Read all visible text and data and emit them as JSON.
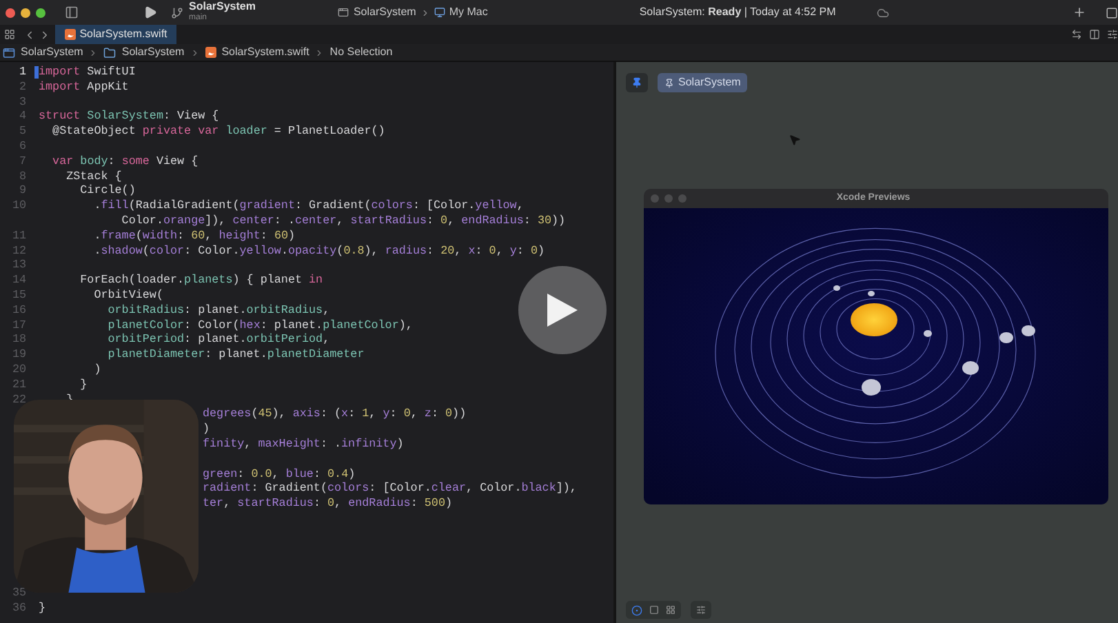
{
  "toolbar": {
    "project": "SolarSystem",
    "branch": "main",
    "scheme": "SolarSystem",
    "destination": "My Mac",
    "status": "SolarSystem: **Ready** | Today at 4:52 PM"
  },
  "tabs": [
    {
      "label": "SolarSystem.swift",
      "selected": true
    }
  ],
  "breadcrumb": [
    {
      "kind": "project",
      "label": "SolarSystem"
    },
    {
      "kind": "folder",
      "label": "SolarSystem"
    },
    {
      "kind": "swift",
      "label": "SolarSystem.swift"
    },
    {
      "kind": "plain",
      "label": "No Selection"
    }
  ],
  "editor": {
    "lines": [
      {
        "kind": "code",
        "number": "1",
        "current": true,
        "tokens": [
          {
            "kind": "keyword",
            "text": "import"
          },
          {
            "kind": "plain",
            "text": " SwiftUI"
          }
        ]
      },
      {
        "kind": "code",
        "number": "2",
        "current": false,
        "tokens": [
          {
            "kind": "keyword",
            "text": "import"
          },
          {
            "kind": "plain",
            "text": " AppKit"
          }
        ]
      },
      {
        "kind": "code",
        "number": "3",
        "current": false
      },
      {
        "kind": "code",
        "number": "4",
        "current": false,
        "tokens": [
          {
            "kind": "keyword",
            "text": "struct"
          },
          {
            "kind": "declared",
            "text": " SolarSystem"
          },
          {
            "kind": "plain",
            "text": ": View {"
          }
        ]
      },
      {
        "kind": "code",
        "number": "5",
        "current": false,
        "tokens": [
          {
            "kind": "plain",
            "text": "  @StateObject "
          },
          {
            "kind": "keyword",
            "text": "private var"
          },
          {
            "kind": "declared",
            "text": " loader"
          },
          {
            "kind": "plain",
            "text": " = PlanetLoader()"
          }
        ]
      },
      {
        "kind": "code",
        "number": "6",
        "current": false
      },
      {
        "kind": "code",
        "number": "7",
        "current": false,
        "tokens": [
          {
            "kind": "keyword",
            "text": "  var"
          },
          {
            "kind": "declared",
            "text": " body"
          },
          {
            "kind": "plain",
            "text": ": "
          },
          {
            "kind": "keyword",
            "text": "some"
          },
          {
            "kind": "plain",
            "text": " View {"
          }
        ]
      },
      {
        "kind": "code",
        "number": "8",
        "current": false,
        "tokens": [
          {
            "kind": "plain",
            "text": "    ZStack {"
          }
        ]
      },
      {
        "kind": "code",
        "number": "9",
        "current": false,
        "tokens": [
          {
            "kind": "plain",
            "text": "      Circle()"
          }
        ]
      },
      {
        "kind": "code",
        "number": "10",
        "current": false,
        "tokens": [
          {
            "kind": "plain",
            "text": "        ."
          },
          {
            "kind": "member",
            "text": "fill"
          },
          {
            "kind": "plain",
            "text": "(RadialGradient("
          },
          {
            "kind": "member",
            "text": "gradient"
          },
          {
            "kind": "plain",
            "text": ": Gradient("
          },
          {
            "kind": "member",
            "text": "colors"
          },
          {
            "kind": "plain",
            "text": ": [Color."
          },
          {
            "kind": "member",
            "text": "yellow"
          },
          {
            "kind": "plain",
            "text": ","
          }
        ]
      },
      {
        "kind": "wrap",
        "tokens": [
          {
            "kind": "plain",
            "text": "            Color."
          },
          {
            "kind": "member",
            "text": "orange"
          },
          {
            "kind": "plain",
            "text": "]), "
          },
          {
            "kind": "member",
            "text": "center"
          },
          {
            "kind": "plain",
            "text": ": ."
          },
          {
            "kind": "member",
            "text": "center"
          },
          {
            "kind": "plain",
            "text": ", "
          },
          {
            "kind": "member",
            "text": "startRadius"
          },
          {
            "kind": "plain",
            "text": ": "
          },
          {
            "kind": "number",
            "text": "0"
          },
          {
            "kind": "plain",
            "text": ", "
          },
          {
            "kind": "member",
            "text": "endRadius"
          },
          {
            "kind": "plain",
            "text": ": "
          },
          {
            "kind": "number",
            "text": "30"
          },
          {
            "kind": "plain",
            "text": "))"
          }
        ]
      },
      {
        "kind": "code",
        "number": "11",
        "current": false,
        "tokens": [
          {
            "kind": "plain",
            "text": "        ."
          },
          {
            "kind": "member",
            "text": "frame"
          },
          {
            "kind": "plain",
            "text": "("
          },
          {
            "kind": "member",
            "text": "width"
          },
          {
            "kind": "plain",
            "text": ": "
          },
          {
            "kind": "number",
            "text": "60"
          },
          {
            "kind": "plain",
            "text": ", "
          },
          {
            "kind": "member",
            "text": "height"
          },
          {
            "kind": "plain",
            "text": ": "
          },
          {
            "kind": "number",
            "text": "60"
          },
          {
            "kind": "plain",
            "text": ")"
          }
        ]
      },
      {
        "kind": "code",
        "number": "12",
        "current": false,
        "tokens": [
          {
            "kind": "plain",
            "text": "        ."
          },
          {
            "kind": "member",
            "text": "shadow"
          },
          {
            "kind": "plain",
            "text": "("
          },
          {
            "kind": "member",
            "text": "color"
          },
          {
            "kind": "plain",
            "text": ": Color."
          },
          {
            "kind": "member",
            "text": "yellow"
          },
          {
            "kind": "plain",
            "text": "."
          },
          {
            "kind": "member",
            "text": "opacity"
          },
          {
            "kind": "plain",
            "text": "("
          },
          {
            "kind": "number",
            "text": "0.8"
          },
          {
            "kind": "plain",
            "text": "), "
          },
          {
            "kind": "member",
            "text": "radius"
          },
          {
            "kind": "plain",
            "text": ": "
          },
          {
            "kind": "number",
            "text": "20"
          },
          {
            "kind": "plain",
            "text": ", "
          },
          {
            "kind": "member",
            "text": "x"
          },
          {
            "kind": "plain",
            "text": ": "
          },
          {
            "kind": "number",
            "text": "0"
          },
          {
            "kind": "plain",
            "text": ", "
          },
          {
            "kind": "member",
            "text": "y"
          },
          {
            "kind": "plain",
            "text": ": "
          },
          {
            "kind": "number",
            "text": "0"
          },
          {
            "kind": "plain",
            "text": ")"
          }
        ]
      },
      {
        "kind": "code",
        "number": "13",
        "current": false
      },
      {
        "kind": "code",
        "number": "14",
        "current": false,
        "tokens": [
          {
            "kind": "plain",
            "text": "      ForEach(loader."
          },
          {
            "kind": "declared",
            "text": "planets"
          },
          {
            "kind": "plain",
            "text": ") { planet "
          },
          {
            "kind": "keyword",
            "text": "in"
          }
        ]
      },
      {
        "kind": "code",
        "number": "15",
        "current": false,
        "tokens": [
          {
            "kind": "plain",
            "text": "        OrbitView("
          }
        ]
      },
      {
        "kind": "code",
        "number": "16",
        "current": false,
        "tokens": [
          {
            "kind": "declared",
            "text": "          orbitRadius"
          },
          {
            "kind": "plain",
            "text": ": planet."
          },
          {
            "kind": "declared",
            "text": "orbitRadius"
          },
          {
            "kind": "plain",
            "text": ","
          }
        ]
      },
      {
        "kind": "code",
        "number": "17",
        "current": false,
        "tokens": [
          {
            "kind": "declared",
            "text": "          planetColor"
          },
          {
            "kind": "plain",
            "text": ": Color("
          },
          {
            "kind": "member",
            "text": "hex"
          },
          {
            "kind": "plain",
            "text": ": planet."
          },
          {
            "kind": "declared",
            "text": "planetColor"
          },
          {
            "kind": "plain",
            "text": "),"
          }
        ]
      },
      {
        "kind": "code",
        "number": "18",
        "current": false,
        "tokens": [
          {
            "kind": "declared",
            "text": "          orbitPeriod"
          },
          {
            "kind": "plain",
            "text": ": planet."
          },
          {
            "kind": "declared",
            "text": "orbitPeriod"
          },
          {
            "kind": "plain",
            "text": ","
          }
        ]
      },
      {
        "kind": "code",
        "number": "19",
        "current": false,
        "tokens": [
          {
            "kind": "declared",
            "text": "          planetDiameter"
          },
          {
            "kind": "plain",
            "text": ": planet."
          },
          {
            "kind": "declared",
            "text": "planetDiameter"
          }
        ]
      },
      {
        "kind": "code",
        "number": "20",
        "current": false,
        "tokens": [
          {
            "kind": "plain",
            "text": "        )"
          }
        ]
      },
      {
        "kind": "code",
        "number": "21",
        "current": false,
        "tokens": [
          {
            "kind": "plain",
            "text": "      }"
          }
        ]
      },
      {
        "kind": "code",
        "number": "22",
        "current": false,
        "tokens": [
          {
            "kind": "plain",
            "text": "    }"
          }
        ]
      },
      {
        "kind": "covered",
        "tokens": [
          {
            "kind": "member",
            "text": "degrees"
          },
          {
            "kind": "plain",
            "text": "("
          },
          {
            "kind": "number",
            "text": "45"
          },
          {
            "kind": "plain",
            "text": "), "
          },
          {
            "kind": "member",
            "text": "axis"
          },
          {
            "kind": "plain",
            "text": ": ("
          },
          {
            "kind": "member",
            "text": "x"
          },
          {
            "kind": "plain",
            "text": ": "
          },
          {
            "kind": "number",
            "text": "1"
          },
          {
            "kind": "plain",
            "text": ", "
          },
          {
            "kind": "member",
            "text": "y"
          },
          {
            "kind": "plain",
            "text": ": "
          },
          {
            "kind": "number",
            "text": "0"
          },
          {
            "kind": "plain",
            "text": ", "
          },
          {
            "kind": "member",
            "text": "z"
          },
          {
            "kind": "plain",
            "text": ": "
          },
          {
            "kind": "number",
            "text": "0"
          },
          {
            "kind": "plain",
            "text": "))"
          }
        ]
      },
      {
        "kind": "covered",
        "tokens": [
          {
            "kind": "plain",
            "text": ")"
          }
        ]
      },
      {
        "kind": "covered",
        "tokens": [
          {
            "kind": "member",
            "text": "finity"
          },
          {
            "kind": "plain",
            "text": ", "
          },
          {
            "kind": "member",
            "text": "maxHeight"
          },
          {
            "kind": "plain",
            "text": ": ."
          },
          {
            "kind": "member",
            "text": "infinity"
          },
          {
            "kind": "plain",
            "text": ")"
          }
        ]
      },
      {
        "kind": "blank"
      },
      {
        "kind": "covered",
        "tokens": [
          {
            "kind": "member",
            "text": "green"
          },
          {
            "kind": "plain",
            "text": ": "
          },
          {
            "kind": "number",
            "text": "0.0"
          },
          {
            "kind": "plain",
            "text": ", "
          },
          {
            "kind": "member",
            "text": "blue"
          },
          {
            "kind": "plain",
            "text": ": "
          },
          {
            "kind": "number",
            "text": "0.4"
          },
          {
            "kind": "plain",
            "text": ")"
          }
        ]
      },
      {
        "kind": "covered",
        "tokens": [
          {
            "kind": "member",
            "text": "radient"
          },
          {
            "kind": "plain",
            "text": ": Gradient("
          },
          {
            "kind": "member",
            "text": "colors"
          },
          {
            "kind": "plain",
            "text": ": [Color."
          },
          {
            "kind": "member",
            "text": "clear"
          },
          {
            "kind": "plain",
            "text": ", Color."
          },
          {
            "kind": "member",
            "text": "black"
          },
          {
            "kind": "plain",
            "text": "]),"
          }
        ]
      },
      {
        "kind": "covered",
        "tokens": [
          {
            "kind": "member",
            "text": "ter"
          },
          {
            "kind": "plain",
            "text": ", "
          },
          {
            "kind": "member",
            "text": "startRadius"
          },
          {
            "kind": "plain",
            "text": ": "
          },
          {
            "kind": "number",
            "text": "0"
          },
          {
            "kind": "plain",
            "text": ", "
          },
          {
            "kind": "member",
            "text": "endRadius"
          },
          {
            "kind": "plain",
            "text": ": "
          },
          {
            "kind": "number",
            "text": "500"
          },
          {
            "kind": "plain",
            "text": ")"
          }
        ]
      },
      {
        "kind": "blank"
      },
      {
        "kind": "blank"
      },
      {
        "kind": "blank"
      },
      {
        "kind": "blank"
      },
      {
        "kind": "blank"
      },
      {
        "kind": "code",
        "number": "35",
        "current": false
      },
      {
        "kind": "code",
        "number": "36",
        "current": false,
        "tokens": [
          {
            "kind": "plain",
            "text": "}"
          }
        ]
      }
    ]
  },
  "canvas": {
    "preview_chip": "SolarSystem",
    "preview_window": {
      "title": "Xcode Previews"
    }
  }
}
